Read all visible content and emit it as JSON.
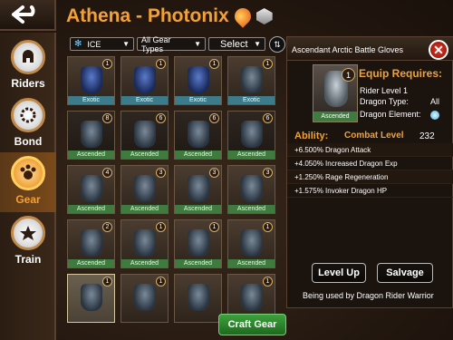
{
  "header": {
    "back_icon": "back-arrow-icon",
    "title": "Athena  - Photonix"
  },
  "sidebar": {
    "items": [
      {
        "label": "Riders",
        "icon": "helmet-icon",
        "active": false
      },
      {
        "label": "Bond",
        "icon": "bond-ring-icon",
        "active": false
      },
      {
        "label": "Gear",
        "icon": "gear-paw-icon",
        "active": true
      },
      {
        "label": "Train",
        "icon": "star-icon",
        "active": false
      }
    ]
  },
  "filters": {
    "element": "ICE",
    "gear_type": "All Gear Types",
    "select": "Select"
  },
  "grid": {
    "cells": [
      {
        "num": "1",
        "tier": "Exotic",
        "style": "blue"
      },
      {
        "num": "1",
        "tier": "Exotic",
        "style": "blue"
      },
      {
        "num": "1",
        "tier": "Exotic",
        "style": "blue"
      },
      {
        "num": "1",
        "tier": "Exotic",
        "style": ""
      },
      {
        "num": "8",
        "tier": "Ascended",
        "style": ""
      },
      {
        "num": "6",
        "tier": "Ascended",
        "style": ""
      },
      {
        "num": "6",
        "tier": "Ascended",
        "style": ""
      },
      {
        "num": "6",
        "tier": "Ascended",
        "style": ""
      },
      {
        "num": "4",
        "tier": "Ascended",
        "style": ""
      },
      {
        "num": "3",
        "tier": "Ascended",
        "style": ""
      },
      {
        "num": "3",
        "tier": "Ascended",
        "style": ""
      },
      {
        "num": "3",
        "tier": "Ascended",
        "style": ""
      },
      {
        "num": "2",
        "tier": "Ascended",
        "style": ""
      },
      {
        "num": "1",
        "tier": "Ascended",
        "style": ""
      },
      {
        "num": "1",
        "tier": "Ascended",
        "style": ""
      },
      {
        "num": "1",
        "tier": "Ascended",
        "style": ""
      },
      {
        "num": "1",
        "tier": "",
        "style": ""
      },
      {
        "num": "1",
        "tier": "",
        "style": ""
      },
      {
        "num": "",
        "tier": "",
        "style": ""
      },
      {
        "num": "1",
        "tier": "",
        "style": ""
      }
    ]
  },
  "panel": {
    "item_name": "Ascendant Arctic Battle Gloves",
    "badge": "1",
    "portrait_tier": "Ascended",
    "equip_title": "Equip Requires:",
    "rider_level": "Rider Level 1",
    "dragon_type_label": "Dragon Type:",
    "dragon_type_value": "All",
    "dragon_element_label": "Dragon Element:",
    "element_icon": "ice-element-icon",
    "ability_title": "Ability:",
    "combat_level_label": "Combat Level",
    "combat_level_value": "232",
    "abilities": [
      "+6.500% Dragon Attack",
      "+4.050% Increased Dragon Exp",
      "+1.250% Rage Regeneration",
      "+1.575% Invoker Dragon HP"
    ],
    "level_up": "Level Up",
    "salvage": "Salvage",
    "used_by": "Being used by Dragon Rider Warrior"
  },
  "craft_button": "Craft Gear"
}
